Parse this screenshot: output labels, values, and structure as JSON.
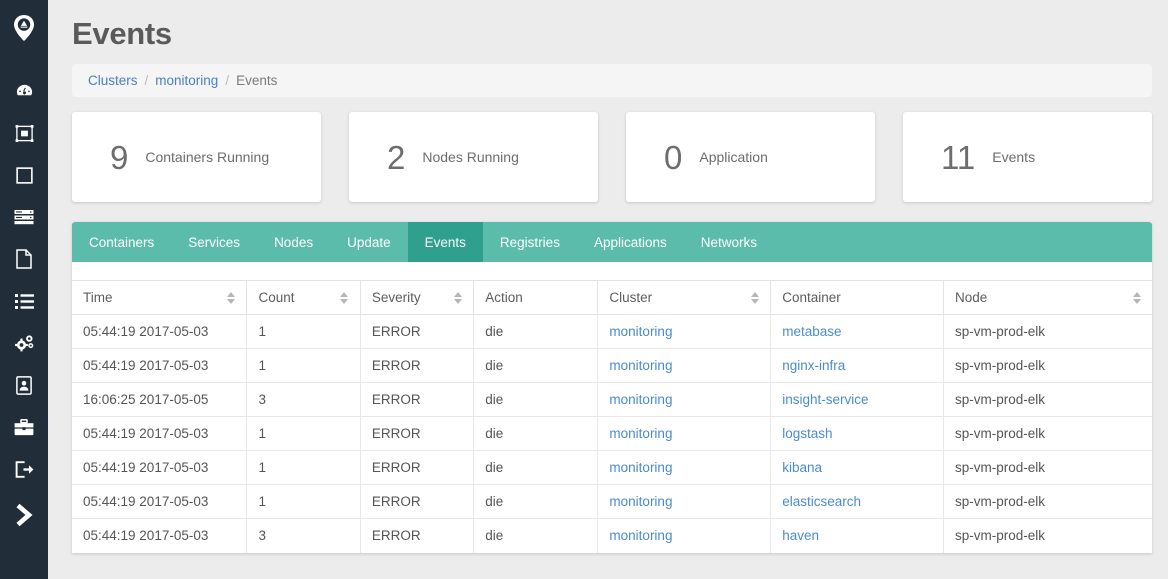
{
  "sidebar": {
    "logo": "location-pin-logo",
    "items": [
      {
        "icon": "dashboard-icon",
        "name": "sidebar-item-dashboard"
      },
      {
        "icon": "cluster-icon",
        "name": "sidebar-item-clusters"
      },
      {
        "icon": "container-icon",
        "name": "sidebar-item-containers"
      },
      {
        "icon": "server-icon",
        "name": "sidebar-item-servers"
      },
      {
        "icon": "document-icon",
        "name": "sidebar-item-documents"
      },
      {
        "icon": "list-icon",
        "name": "sidebar-item-list"
      },
      {
        "icon": "settings-gears-icon",
        "name": "sidebar-item-settings"
      },
      {
        "icon": "id-card-icon",
        "name": "sidebar-item-account"
      },
      {
        "icon": "briefcase-icon",
        "name": "sidebar-item-projects"
      },
      {
        "icon": "logout-icon",
        "name": "sidebar-item-logout"
      },
      {
        "icon": "chevron-right-icon",
        "name": "sidebar-expander"
      }
    ]
  },
  "header": {
    "title": "Events"
  },
  "breadcrumb": {
    "root": "Clusters",
    "parent": "monitoring",
    "current": "Events",
    "separator": "/"
  },
  "cards": [
    {
      "value": "9",
      "label": "Containers Running"
    },
    {
      "value": "2",
      "label": "Nodes Running"
    },
    {
      "value": "0",
      "label": "Application"
    },
    {
      "value": "11",
      "label": "Events"
    }
  ],
  "tabs": [
    {
      "label": "Containers",
      "active": false
    },
    {
      "label": "Services",
      "active": false
    },
    {
      "label": "Nodes",
      "active": false
    },
    {
      "label": "Update",
      "active": false
    },
    {
      "label": "Events",
      "active": true
    },
    {
      "label": "Registries",
      "active": false
    },
    {
      "label": "Applications",
      "active": false
    },
    {
      "label": "Networks",
      "active": false
    }
  ],
  "table": {
    "columns": [
      {
        "label": "Time",
        "sortable": true
      },
      {
        "label": "Count",
        "sortable": true
      },
      {
        "label": "Severity",
        "sortable": true
      },
      {
        "label": "Action",
        "sortable": false
      },
      {
        "label": "Cluster",
        "sortable": true
      },
      {
        "label": "Container",
        "sortable": false
      },
      {
        "label": "Node",
        "sortable": true
      }
    ],
    "rows": [
      {
        "time": "05:44:19 2017-05-03",
        "count": "1",
        "severity": "ERROR",
        "action": "die",
        "cluster": "monitoring",
        "container": "metabase",
        "node": "sp-vm-prod-elk"
      },
      {
        "time": "05:44:19 2017-05-03",
        "count": "1",
        "severity": "ERROR",
        "action": "die",
        "cluster": "monitoring",
        "container": "nginx-infra",
        "node": "sp-vm-prod-elk"
      },
      {
        "time": "16:06:25 2017-05-05",
        "count": "3",
        "severity": "ERROR",
        "action": "die",
        "cluster": "monitoring",
        "container": "insight-service",
        "node": "sp-vm-prod-elk"
      },
      {
        "time": "05:44:19 2017-05-03",
        "count": "1",
        "severity": "ERROR",
        "action": "die",
        "cluster": "monitoring",
        "container": "logstash",
        "node": "sp-vm-prod-elk"
      },
      {
        "time": "05:44:19 2017-05-03",
        "count": "1",
        "severity": "ERROR",
        "action": "die",
        "cluster": "monitoring",
        "container": "kibana",
        "node": "sp-vm-prod-elk"
      },
      {
        "time": "05:44:19 2017-05-03",
        "count": "1",
        "severity": "ERROR",
        "action": "die",
        "cluster": "monitoring",
        "container": "elasticsearch",
        "node": "sp-vm-prod-elk"
      },
      {
        "time": "05:44:19 2017-05-03",
        "count": "3",
        "severity": "ERROR",
        "action": "die",
        "cluster": "monitoring",
        "container": "haven",
        "node": "sp-vm-prod-elk"
      }
    ]
  },
  "colors": {
    "sidebar_bg": "#222d3a",
    "tabbar": "#5cbcab",
    "tab_active": "#2ea08d",
    "link": "#4a8ccb",
    "page_bg": "#ececec"
  }
}
